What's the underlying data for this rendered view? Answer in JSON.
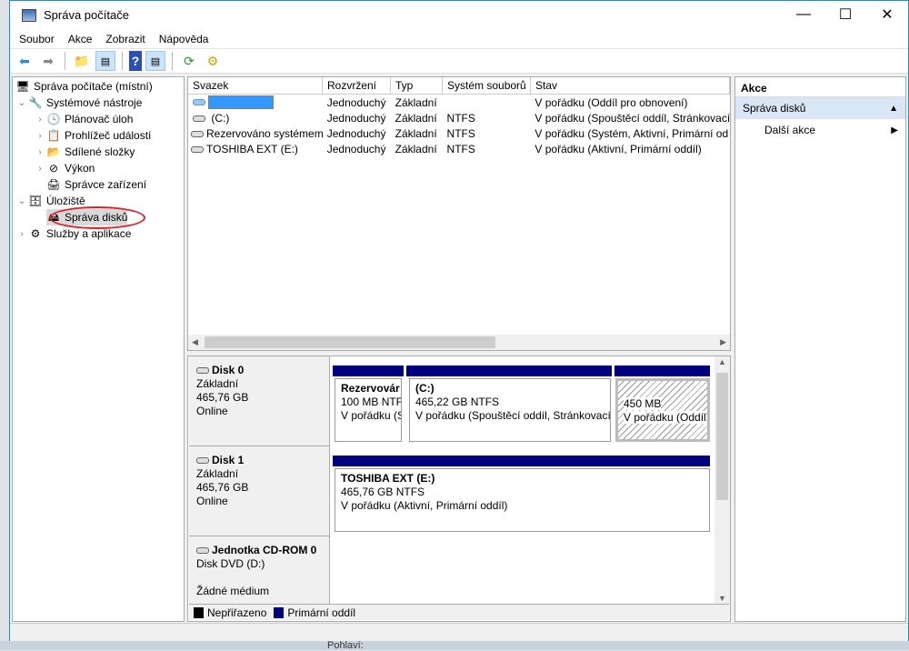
{
  "window": {
    "title": "Správa počítače",
    "minimize": "—",
    "maximize": "☐",
    "close": "✕"
  },
  "menu": [
    "Soubor",
    "Akce",
    "Zobrazit",
    "Nápověda"
  ],
  "tree": {
    "root": "Správa počítače (místní)",
    "items": [
      "Systémové nástroje",
      "Plánovač úloh",
      "Prohlížeč událostí",
      "Sdílené složky",
      "Výkon",
      "Správce zařízení",
      "Úložiště",
      "Správa disků",
      "Služby a aplikace"
    ]
  },
  "volumes": {
    "columns": [
      "Svazek",
      "Rozvržení",
      "Typ",
      "Systém souborů",
      "Stav"
    ],
    "rows": [
      [
        "",
        "Jednoduchý",
        "Základní",
        "",
        "V pořádku (Oddíl pro obnovení)"
      ],
      [
        " (C:)",
        "Jednoduchý",
        "Základní",
        "NTFS",
        "V pořádku (Spouštěcí oddíl, Stránkovací"
      ],
      [
        "Rezervováno systémem",
        "Jednoduchý",
        "Základní",
        "NTFS",
        "V pořádku (Systém, Aktivní, Primární od"
      ],
      [
        "TOSHIBA EXT (E:)",
        "Jednoduchý",
        "Základní",
        "NTFS",
        "V pořádku (Aktivní, Primární oddíl)"
      ]
    ]
  },
  "disks": [
    {
      "name": "Disk 0",
      "type": "Základní",
      "size": "465,76 GB",
      "status": "Online",
      "partitions": [
        {
          "name": "Rezervovár",
          "size": "100 MB NTF",
          "state": "V pořádku (S"
        },
        {
          "name": " (C:)",
          "size": "465,22 GB NTFS",
          "state": "V pořádku (Spouštěcí oddíl, Stránkovací :"
        },
        {
          "name": "",
          "size": "450 MB",
          "state": "V pořádku (Oddíl"
        }
      ]
    },
    {
      "name": "Disk 1",
      "type": "Základní",
      "size": "465,76 GB",
      "status": "Online",
      "partitions": [
        {
          "name": "TOSHIBA EXT  (E:)",
          "size": "465,76 GB NTFS",
          "state": "V pořádku (Aktivní, Primární oddíl)"
        }
      ]
    },
    {
      "name": "Jednotka CD-ROM 0",
      "type": "Disk DVD (D:)",
      "status": "Žádné médium"
    }
  ],
  "legend": [
    {
      "label": "Nepřiřazeno",
      "color": "#000000"
    },
    {
      "label": "Primární oddíl",
      "color": "#00007f"
    }
  ],
  "actions": {
    "title": "Akce",
    "section": "Správa disků",
    "more": "Další akce"
  },
  "background": {
    "text": "Pohlaví:"
  },
  "colors": {
    "primary_partition": "#00007f",
    "selection": "#3399ff",
    "highlight_circle": "#e0202a"
  }
}
